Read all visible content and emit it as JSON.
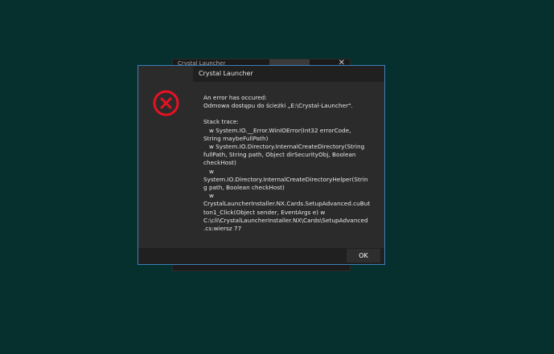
{
  "background_window": {
    "title": "Crystal Launcher",
    "tab_label": "",
    "close_glyph": "✕"
  },
  "dialog": {
    "title": "Crystal Launcher",
    "icon": "error-icon",
    "message_lines": [
      "An error has occured:",
      "Odmowa dostępu do ścieżki „E:\\Crystal-Launcher\".",
      "",
      "Stack trace:",
      "   w System.IO.__Error.WinIOError(Int32 errorCode,",
      "String maybeFullPath)",
      "   w System.IO.Directory.InternalCreateDirectory(String",
      "fullPath, String path, Object dirSecurityObj, Boolean",
      "checkHost)",
      "   w",
      "System.IO.Directory.InternalCreateDirectoryHelper(Strin",
      "g path, Boolean checkHost)",
      "   w",
      "CrystalLauncherInstaller.NX.Cards.SetupAdvanced.cuBut",
      "ton1_Click(Object sender, EventArgs e) w",
      "C:\\cli\\CrystalLauncherInstaller.NX\\Cards\\SetupAdvanced",
      ".cs:wiersz 77"
    ],
    "ok_label": "OK"
  },
  "colors": {
    "desktop": "#05302e",
    "dialog_bg": "#2b2b2b",
    "dialog_border": "#3d7fb9",
    "error_red": "#e81123"
  }
}
